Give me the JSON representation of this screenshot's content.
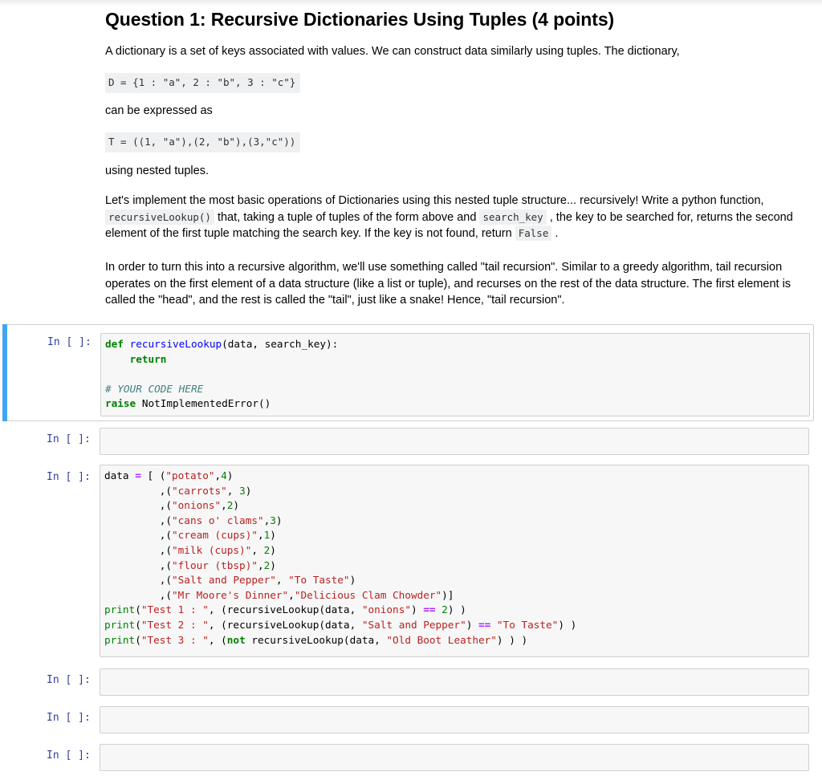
{
  "markdown": {
    "title": "Question 1: Recursive Dictionaries Using Tuples (4 points)",
    "p1": "A dictionary is a set of keys associated with values. We can construct data similarly using tuples. The dictionary,",
    "code_dict": "D = {1 : \"a\", 2 : \"b\", 3 : \"c\"}",
    "p2": "can be expressed as",
    "code_tuple": "T = ((1, \"a\"),(2, \"b\"),(3,\"c\"))",
    "p3": "using nested tuples.",
    "p4": {
      "a": "Let's implement the most basic operations of Dictionaries using this nested tuple structure... recursively! Write a python function, ",
      "code1": "recursiveLookup()",
      "b": " that, taking a tuple of tuples of the form above and ",
      "code2": "search_key",
      "c": " , the key to be searched for, returns the second element of the first tuple matching the search key. If the key is not found, return ",
      "code3": "False",
      "d": " ."
    },
    "p5": "In order to turn this into a recursive algorithm, we'll use something called \"tail recursion\". Similar to a greedy algorithm, tail recursion operates on the first element of a data structure (like a list or tuple), and recurses on the rest of the data structure. The first element is called the \"head\", and the rest is called the \"tail\", just like a snake! Hence, \"tail recursion\"."
  },
  "cells": [
    {
      "prompt": "In [ ]:",
      "selected": true,
      "tokens": {
        "def": "def",
        "fname": "recursiveLookup",
        "args": "(data, search_key):",
        "indent": "    ",
        "ret": "return",
        "comment": "# YOUR CODE HERE",
        "raise": "raise",
        "err": " NotImplementedError()"
      }
    },
    {
      "prompt": "In [ ]:",
      "source": ""
    },
    {
      "prompt": "In [ ]:",
      "data_items": [
        {
          "key": "\"potato\"",
          "sep": ",",
          "val": "4",
          "type": "num"
        },
        {
          "key": "\"carrots\"",
          "sep": ", ",
          "val": "3",
          "type": "num"
        },
        {
          "key": "\"onions\"",
          "sep": ",",
          "val": "2",
          "type": "num"
        },
        {
          "key": "\"cans o' clams\"",
          "sep": ",",
          "val": "3",
          "type": "num"
        },
        {
          "key": "\"cream (cups)\"",
          "sep": ",",
          "val": "1",
          "type": "num"
        },
        {
          "key": "\"milk (cups)\"",
          "sep": ", ",
          "val": "2",
          "type": "num"
        },
        {
          "key": "\"flour (tbsp)\"",
          "sep": ",",
          "val": "2",
          "type": "num"
        },
        {
          "key": "\"Salt and Pepper\"",
          "sep": ", ",
          "val": "\"To Taste\"",
          "type": "str"
        },
        {
          "key": "\"Mr Moore's Dinner\"",
          "sep": ",",
          "val": "\"Delicious Clam Chowder\"",
          "type": "str"
        }
      ],
      "tests": [
        {
          "label": "\"Test 1 : \"",
          "pre": "",
          "key": "\"onions\"",
          "cmp": "==",
          "expected": "2",
          "expected_type": "num"
        },
        {
          "label": "\"Test 2 : \"",
          "pre": "",
          "key": "\"Salt and Pepper\"",
          "cmp": "==",
          "expected": "\"To Taste\"",
          "expected_type": "str"
        },
        {
          "label": "\"Test 3 : \"",
          "pre": "not",
          "key": "\"Old Boot Leather\"",
          "cmp": "",
          "expected": "",
          "expected_type": ""
        }
      ]
    },
    {
      "prompt": "In [ ]:",
      "source": ""
    },
    {
      "prompt": "In [ ]:",
      "source": ""
    },
    {
      "prompt": "In [ ]:",
      "source": ""
    }
  ],
  "colors": {
    "selection_bar": "#42a5f5",
    "prompt": "#303f9f",
    "keyword": "#008000",
    "string": "#ba2121",
    "function": "#0000ff",
    "operator": "#aa22ff",
    "comment": "#408080"
  }
}
